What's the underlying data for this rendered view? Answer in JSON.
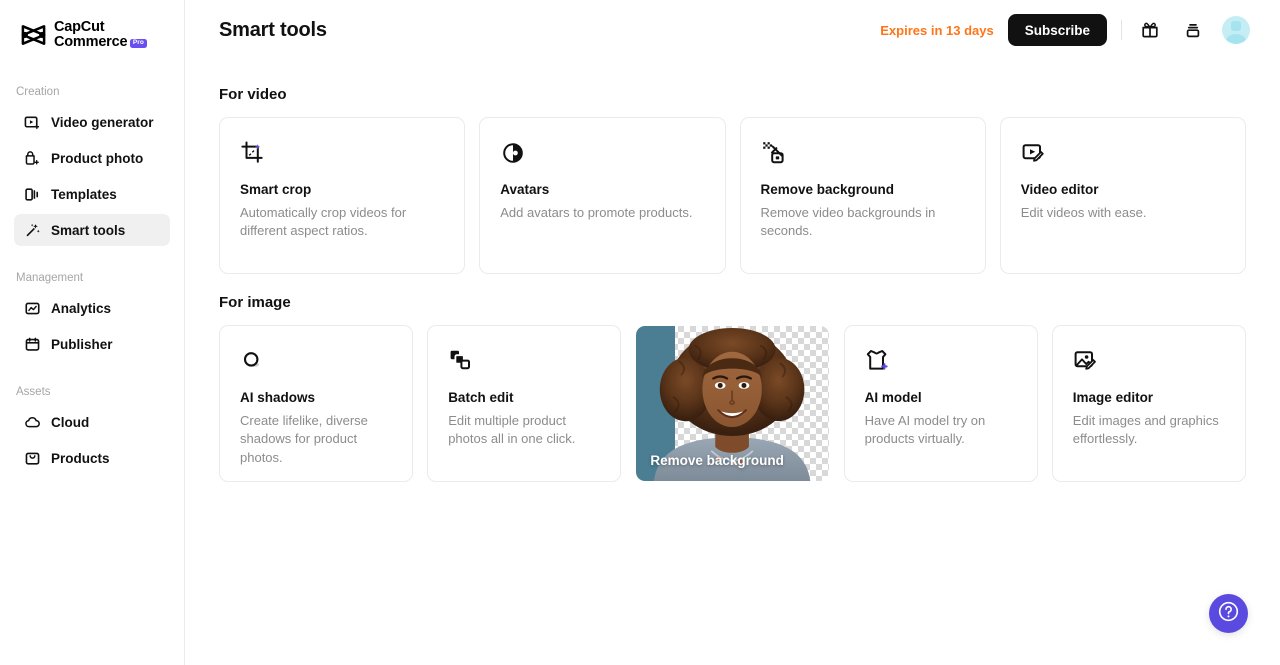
{
  "brand": {
    "name_line1": "CapCut",
    "name_line2": "Commerce",
    "badge": "Pro",
    "badge_color": "#6a4ff0"
  },
  "sidebar": {
    "groups": [
      {
        "label": "Creation",
        "items": [
          {
            "label": "Video generator",
            "icon": "video-generator-icon",
            "active": false
          },
          {
            "label": "Product photo",
            "icon": "product-photo-icon",
            "active": false
          },
          {
            "label": "Templates",
            "icon": "templates-icon",
            "active": false
          },
          {
            "label": "Smart tools",
            "icon": "smart-tools-icon",
            "active": true
          }
        ]
      },
      {
        "label": "Management",
        "items": [
          {
            "label": "Analytics",
            "icon": "analytics-icon",
            "active": false
          },
          {
            "label": "Publisher",
            "icon": "publisher-icon",
            "active": false
          }
        ]
      },
      {
        "label": "Assets",
        "items": [
          {
            "label": "Cloud",
            "icon": "cloud-icon",
            "active": false
          },
          {
            "label": "Products",
            "icon": "products-icon",
            "active": false
          }
        ]
      }
    ]
  },
  "header": {
    "title": "Smart tools",
    "expires_text": "Expires in 13 days",
    "expires_color": "#ff7518",
    "subscribe_label": "Subscribe",
    "icons": [
      "gift-icon",
      "stack-icon"
    ],
    "avatar": "user-avatar"
  },
  "sections": [
    {
      "title": "For video",
      "cards": [
        {
          "title": "Smart crop",
          "desc": "Automatically crop videos for different aspect ratios.",
          "icon": "smart-crop-icon",
          "state": "default"
        },
        {
          "title": "Avatars",
          "desc": "Add avatars to promote products.",
          "icon": "avatars-icon",
          "state": "default"
        },
        {
          "title": "Remove background",
          "desc": "Remove video backgrounds in seconds.",
          "icon": "remove-background-icon",
          "state": "default"
        },
        {
          "title": "Video editor",
          "desc": "Edit videos with ease.",
          "icon": "video-editor-icon",
          "state": "default"
        }
      ]
    },
    {
      "title": "For image",
      "cards": [
        {
          "title": "AI shadows",
          "desc": "Create lifelike, diverse shadows for product photos.",
          "icon": "ai-shadows-icon",
          "state": "default"
        },
        {
          "title": "Batch edit",
          "desc": "Edit multiple product photos all in one click.",
          "icon": "batch-edit-icon",
          "state": "default"
        },
        {
          "title": "Remove background",
          "desc": "",
          "icon": "remove-background-icon",
          "state": "preview"
        },
        {
          "title": "AI model",
          "desc": "Have AI model try on products virtually.",
          "icon": "ai-model-icon",
          "state": "default"
        },
        {
          "title": "Image editor",
          "desc": "Edit images and graphics effortlessly.",
          "icon": "image-editor-icon",
          "state": "default"
        }
      ]
    }
  ],
  "help": {
    "icon": "help-circle-icon",
    "color": "#5b4ae0"
  }
}
